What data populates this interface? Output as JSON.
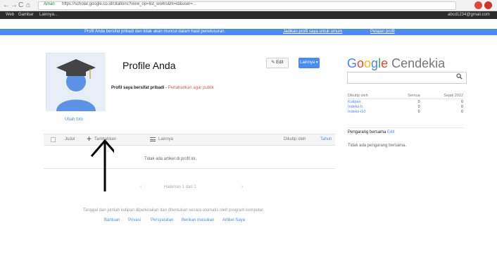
{
  "browser": {
    "secure_label": "Aman",
    "url": "https://scholar.google.co.id/citations?view_op=list_works&hl=id&user=...",
    "nav_back": "←",
    "nav_forward": "→",
    "nav_reload": "C",
    "home": "⌂"
  },
  "apps_bar": {
    "items": [
      "Web",
      "Gambar",
      "Lainnya..."
    ],
    "account": "abcd1234@gmail.com"
  },
  "notice": {
    "text": "Profil Anda bersifat pribadi dan tidak akan muncul dalam hasil penelusuran.",
    "link1": "Jadikan profil saya untuk umum",
    "link2": "Pelajari profil"
  },
  "profile": {
    "title": "Profile Anda",
    "visibility_bold": "Profil saya bersifat pribadi",
    "visibility_link": "Pertahankan agar publik",
    "avatar_edit": "Ubah foto",
    "edit_button": "✎ Edit",
    "more_button": "Lainnya ▾"
  },
  "toolbar": {
    "items": [
      "Judul",
      "Tambahkan",
      "Lainnya"
    ],
    "sort_label": "Dikutip oleh",
    "year_label": "Tahun"
  },
  "articles": {
    "empty_message": "Tidak ada artikel di profil ini."
  },
  "pager": {
    "prev": "‹",
    "label": "Halaman 1 dari 1",
    "next": "›"
  },
  "footer": {
    "note": "Tanggal dan jumlah kutipan diperkirakan dan ditentukan secara otomatis oleh program komputer.",
    "links": [
      "Bantuan",
      "Privasi",
      "Persyaratan",
      "Berikan masukan",
      "Artikel Saya"
    ]
  },
  "sidebar": {
    "logo_g": "G",
    "logo_o1": "o",
    "logo_o2": "o",
    "logo_g2": "g",
    "logo_l": "l",
    "logo_e": "e",
    "logo_rest": "Cendekia",
    "citations": {
      "headers": [
        "Dikutip oleh",
        "Semua",
        "Sejak 2012"
      ],
      "rows": [
        {
          "label": "Kutipan",
          "all": "0",
          "since": "0"
        },
        {
          "label": "Indeks-h",
          "all": "0",
          "since": "0"
        },
        {
          "label": "Indeks-i10",
          "all": "0",
          "since": "0"
        }
      ]
    },
    "coauthors_title": "Pengarang bersama",
    "coauthors_edit": "Edit",
    "coauthors_empty": "Tidak ada pengarang bersama."
  },
  "colors": {
    "accent": "#4a8af4",
    "notice_bar": "#4a8af4",
    "link_red": "#d25b5b"
  }
}
